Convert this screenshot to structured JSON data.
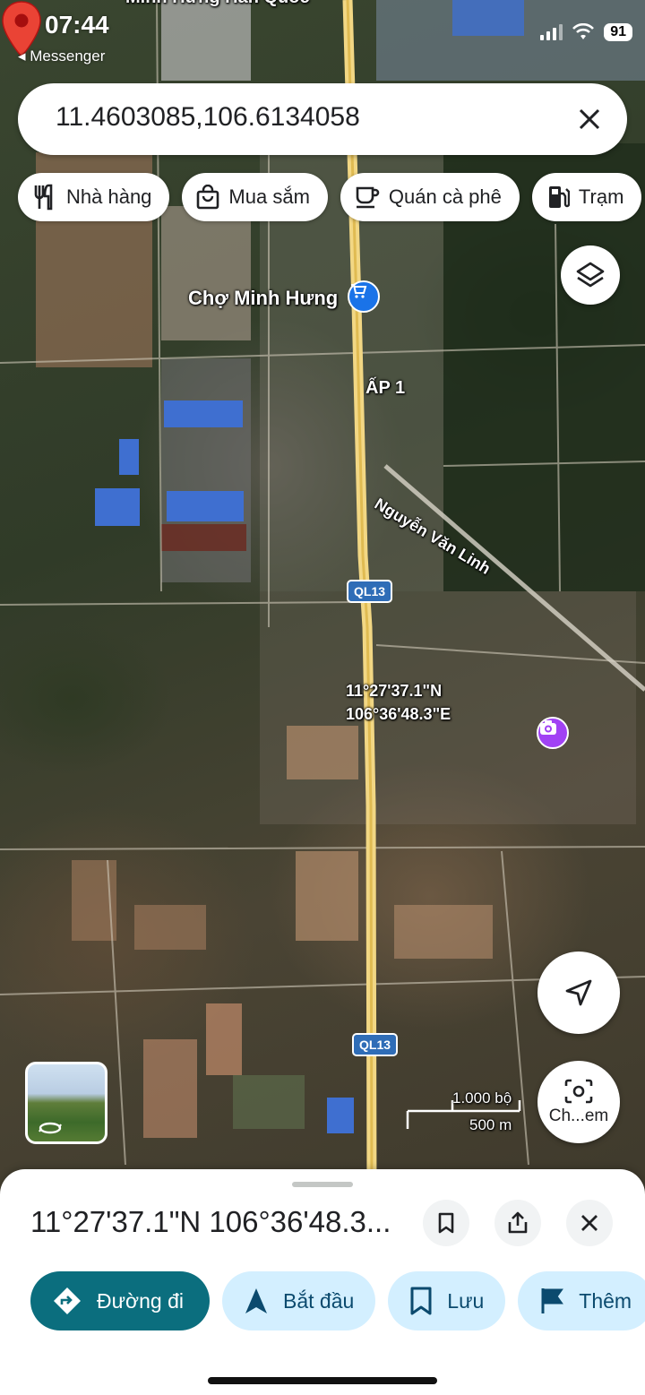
{
  "status_bar": {
    "time": "07:44",
    "back_app": "◂ Messenger",
    "battery": "91"
  },
  "search": {
    "value": "11.4603085,106.6134058",
    "close_icon": "close-icon"
  },
  "chips": [
    {
      "label": "Nhà hàng",
      "icon": "restaurant-icon"
    },
    {
      "label": "Mua sắm",
      "icon": "shopping-bag-icon"
    },
    {
      "label": "Quán cà phê",
      "icon": "coffee-icon"
    },
    {
      "label": "Trạm",
      "icon": "gas-station-icon"
    }
  ],
  "map": {
    "label_top": "Minh Hưng Hàn Quốc",
    "market": "Chợ Minh Hưng",
    "hamlet": "ẤP 1",
    "street": "Nguyễn Văn Linh",
    "route_shield_1": "QL13",
    "route_shield_2": "QL13",
    "pin_coords": "11°27'37.1\"N\n106°36'48.3\"E",
    "scale_ft": "1.000 bộ",
    "scale_m": "500 m",
    "lens_label": "Ch...em"
  },
  "sheet": {
    "title": "11°27'37.1\"N 106°36'48.3...",
    "actions": [
      {
        "label": "Đường đi",
        "icon": "directions-icon"
      },
      {
        "label": "Bắt đầu",
        "icon": "navigate-icon"
      },
      {
        "label": "Lưu",
        "icon": "bookmark-icon"
      },
      {
        "label": "Thêm",
        "icon": "flag-icon"
      }
    ]
  },
  "colors": {
    "primary_action": "#0b6e7e",
    "secondary_action": "#d3efff",
    "pin": "#ea4335",
    "shield": "#2f6db7"
  }
}
